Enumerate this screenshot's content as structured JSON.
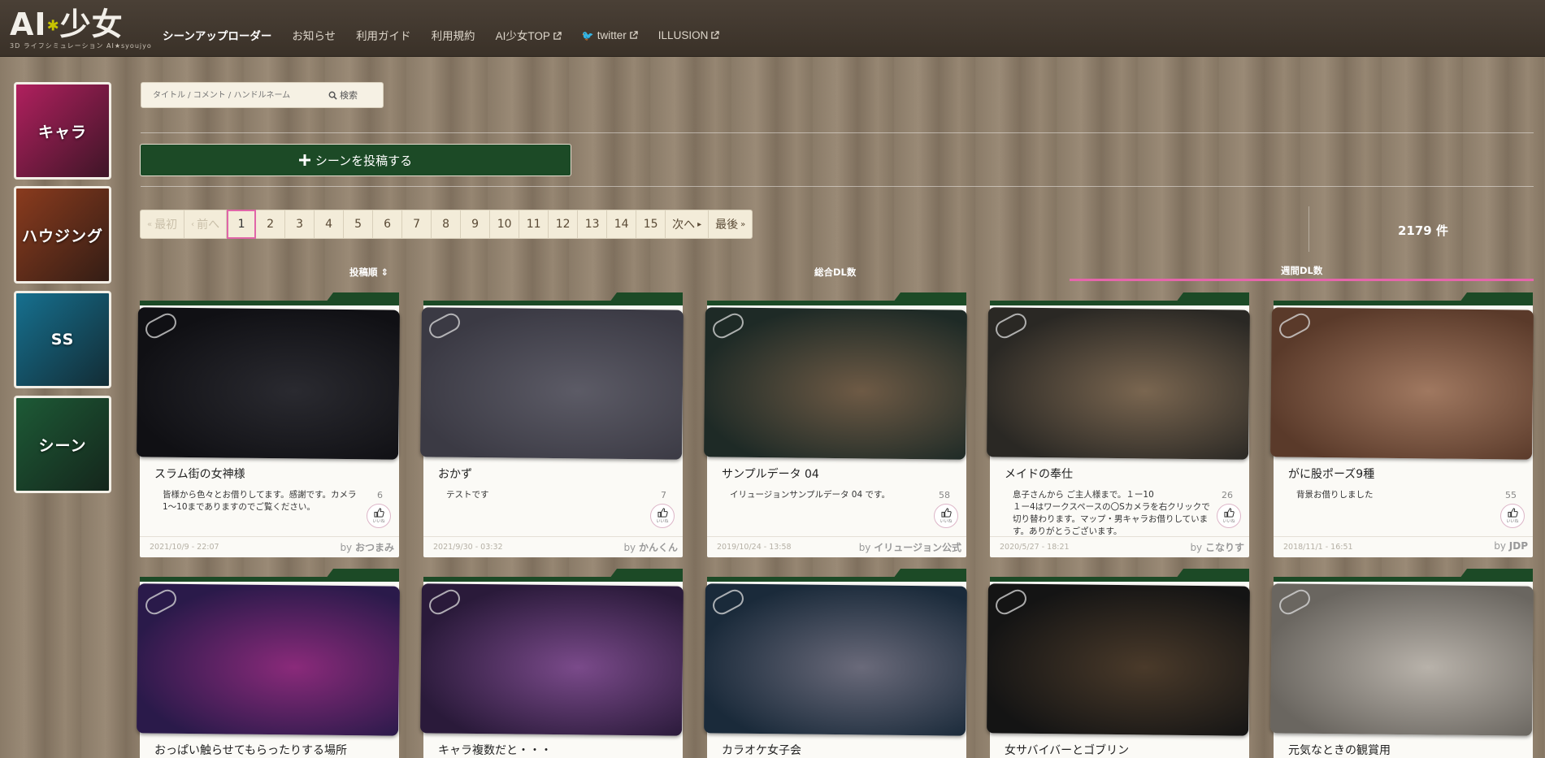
{
  "header": {
    "logo_main": "AI",
    "logo_star": "✱",
    "logo_main2": "少女",
    "logo_sub": "3D ライフシミュレーション  AI★syoujyo",
    "nav": [
      {
        "label": "シーンアップローダー",
        "active": true,
        "external": false
      },
      {
        "label": "お知らせ",
        "active": false,
        "external": false
      },
      {
        "label": "利用ガイド",
        "active": false,
        "external": false
      },
      {
        "label": "利用規約",
        "active": false,
        "external": false
      },
      {
        "label": "AI少女TOP",
        "active": false,
        "external": true
      },
      {
        "label": "twitter",
        "active": false,
        "external": true,
        "twitter": true
      },
      {
        "label": "ILLUSION",
        "active": false,
        "external": true
      }
    ]
  },
  "sidebar": {
    "items": [
      {
        "label": "キャラ",
        "color": "#b0205e"
      },
      {
        "label": "ハウジング",
        "color": "#8a3b1e"
      },
      {
        "label": "SS",
        "color": "#16708f"
      },
      {
        "label": "シーン",
        "color": "#1d5a36"
      }
    ]
  },
  "search": {
    "placeholder": "タイトル / コメント / ハンドルネーム",
    "button": "検索"
  },
  "post_button": "シーンを投稿する",
  "pagination": {
    "first": "最初",
    "prev": "前へ",
    "pages": [
      "1",
      "2",
      "3",
      "4",
      "5",
      "6",
      "7",
      "8",
      "9",
      "10",
      "11",
      "12",
      "13",
      "14",
      "15"
    ],
    "current": "1",
    "next": "次へ",
    "last": "最後"
  },
  "result_count": "2179 件",
  "sort": {
    "by_date": "投稿順",
    "by_total": "総合DL数",
    "by_weekly": "週間DL数",
    "active": "by_weekly"
  },
  "cards": [
    {
      "title": "スラム街の女神様",
      "desc": "皆様から色々とお借りしてます。感謝です。カメラ1〜10までありますのでご覧ください。",
      "likes": "6",
      "date": "2021/10/9 - 22:07",
      "author": "おつまみ",
      "colors": [
        "#101014",
        "#2a2a30"
      ]
    },
    {
      "title": "おかず",
      "desc": "テストです",
      "likes": "7",
      "date": "2021/9/30 - 03:32",
      "author": "かんくん",
      "colors": [
        "#3b3a44",
        "#5c5b66"
      ]
    },
    {
      "title": "サンプルデータ 04",
      "desc": "イリュージョンサンプルデータ 04 です。",
      "likes": "58",
      "date": "2019/10/24 - 13:58",
      "author": "イリュージョン公式",
      "colors": [
        "#1e2a26",
        "#6e5a45"
      ]
    },
    {
      "title": "メイドの奉仕",
      "desc": "息子さんから ご主人様まで。１ー10\n１ー4はワークスペースの〇Sカメラを右クリックで切り替わります。マップ・男キャラお借りしています。ありがとうございます。",
      "likes": "26",
      "date": "2020/5/27 - 18:21",
      "author": "こなりす",
      "colors": [
        "#2a2824",
        "#7a6650"
      ]
    },
    {
      "title": "がに股ポーズ9種",
      "desc": "背景お借りしました",
      "likes": "55",
      "date": "2018/11/1 - 16:51",
      "author": "JDP",
      "colors": [
        "#5a3a2a",
        "#a07860"
      ]
    },
    {
      "title": "おっぱい触らせてもらったりする場所",
      "desc": "",
      "likes": "",
      "date": "",
      "author": "",
      "colors": [
        "#2a1a4a",
        "#8a2a7a"
      ]
    },
    {
      "title": "キャラ複数だと・・・",
      "desc": "",
      "likes": "",
      "date": "",
      "author": "",
      "colors": [
        "#2a1a3a",
        "#7a4a8a"
      ]
    },
    {
      "title": "カラオケ女子会",
      "desc": "",
      "likes": "",
      "date": "",
      "author": "",
      "colors": [
        "#1a2a3a",
        "#6a6a7a"
      ]
    },
    {
      "title": "女サバイバーとゴブリン",
      "desc": "",
      "likes": "",
      "date": "",
      "author": "",
      "colors": [
        "#141414",
        "#4a3a2a"
      ]
    },
    {
      "title": "元気なときの観賞用",
      "desc": "",
      "likes": "",
      "date": "",
      "author": "",
      "colors": [
        "#6a6660",
        "#b8b2aa"
      ]
    }
  ]
}
